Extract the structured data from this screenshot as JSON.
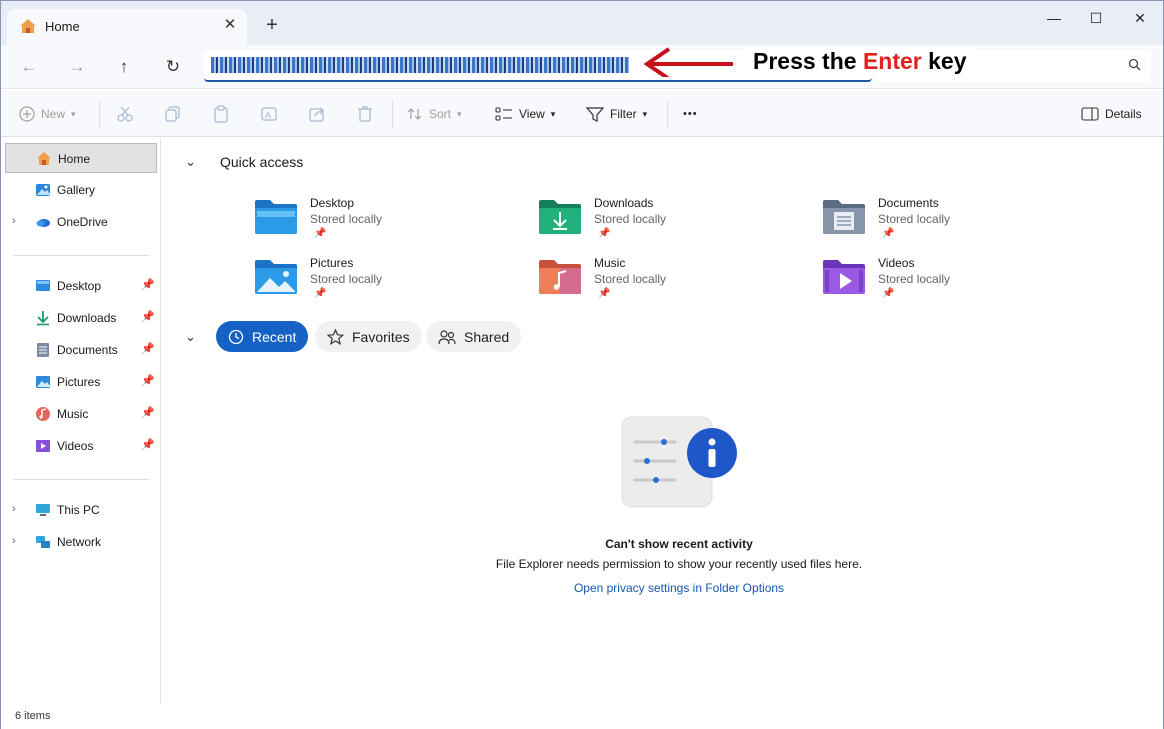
{
  "window": {
    "tab_title": "Home",
    "tab_close": "✕",
    "new_tab": "+",
    "minimize": "—",
    "maximize": "☐",
    "close": "✕"
  },
  "nav": {
    "back": "←",
    "forward": "→",
    "up": "↑",
    "refresh": "↻"
  },
  "annotation": {
    "prefix": "Press the ",
    "highlight": "Enter",
    "suffix": " key",
    "highlight_color": "#e0201b"
  },
  "commands": {
    "new": "New",
    "sort": "Sort",
    "view": "View",
    "filter": "Filter",
    "more": "•••",
    "details": "Details"
  },
  "sidebar": {
    "top": [
      {
        "label": "Home",
        "icon": "home-icon",
        "selected": true
      },
      {
        "label": "Gallery",
        "icon": "gallery-icon"
      },
      {
        "label": "OneDrive",
        "icon": "onedrive-icon",
        "expandable": true
      }
    ],
    "pinned": [
      {
        "label": "Desktop",
        "icon": "desktop-icon"
      },
      {
        "label": "Downloads",
        "icon": "downloads-icon"
      },
      {
        "label": "Documents",
        "icon": "documents-icon"
      },
      {
        "label": "Pictures",
        "icon": "pictures-icon"
      },
      {
        "label": "Music",
        "icon": "music-icon"
      },
      {
        "label": "Videos",
        "icon": "videos-icon"
      }
    ],
    "bottom": [
      {
        "label": "This PC",
        "icon": "this-pc-icon"
      },
      {
        "label": "Network",
        "icon": "network-icon"
      }
    ]
  },
  "quick_access": {
    "title": "Quick access",
    "items": [
      {
        "name": "Desktop",
        "sub": "Stored locally",
        "icon": "desktop-folder-icon"
      },
      {
        "name": "Downloads",
        "sub": "Stored locally",
        "icon": "downloads-folder-icon"
      },
      {
        "name": "Documents",
        "sub": "Stored locally",
        "icon": "documents-folder-icon"
      },
      {
        "name": "Pictures",
        "sub": "Stored locally",
        "icon": "pictures-folder-icon"
      },
      {
        "name": "Music",
        "sub": "Stored locally",
        "icon": "music-folder-icon"
      },
      {
        "name": "Videos",
        "sub": "Stored locally",
        "icon": "videos-folder-icon"
      }
    ]
  },
  "filters": {
    "recent": "Recent",
    "favorites": "Favorites",
    "shared": "Shared"
  },
  "empty_state": {
    "title": "Can't show recent activity",
    "description": "File Explorer needs permission to show your recently used files here.",
    "link": "Open privacy settings in Folder Options"
  },
  "status": {
    "items": "6 items"
  },
  "colors": {
    "accent": "#1662c4",
    "link": "#1558b0"
  }
}
